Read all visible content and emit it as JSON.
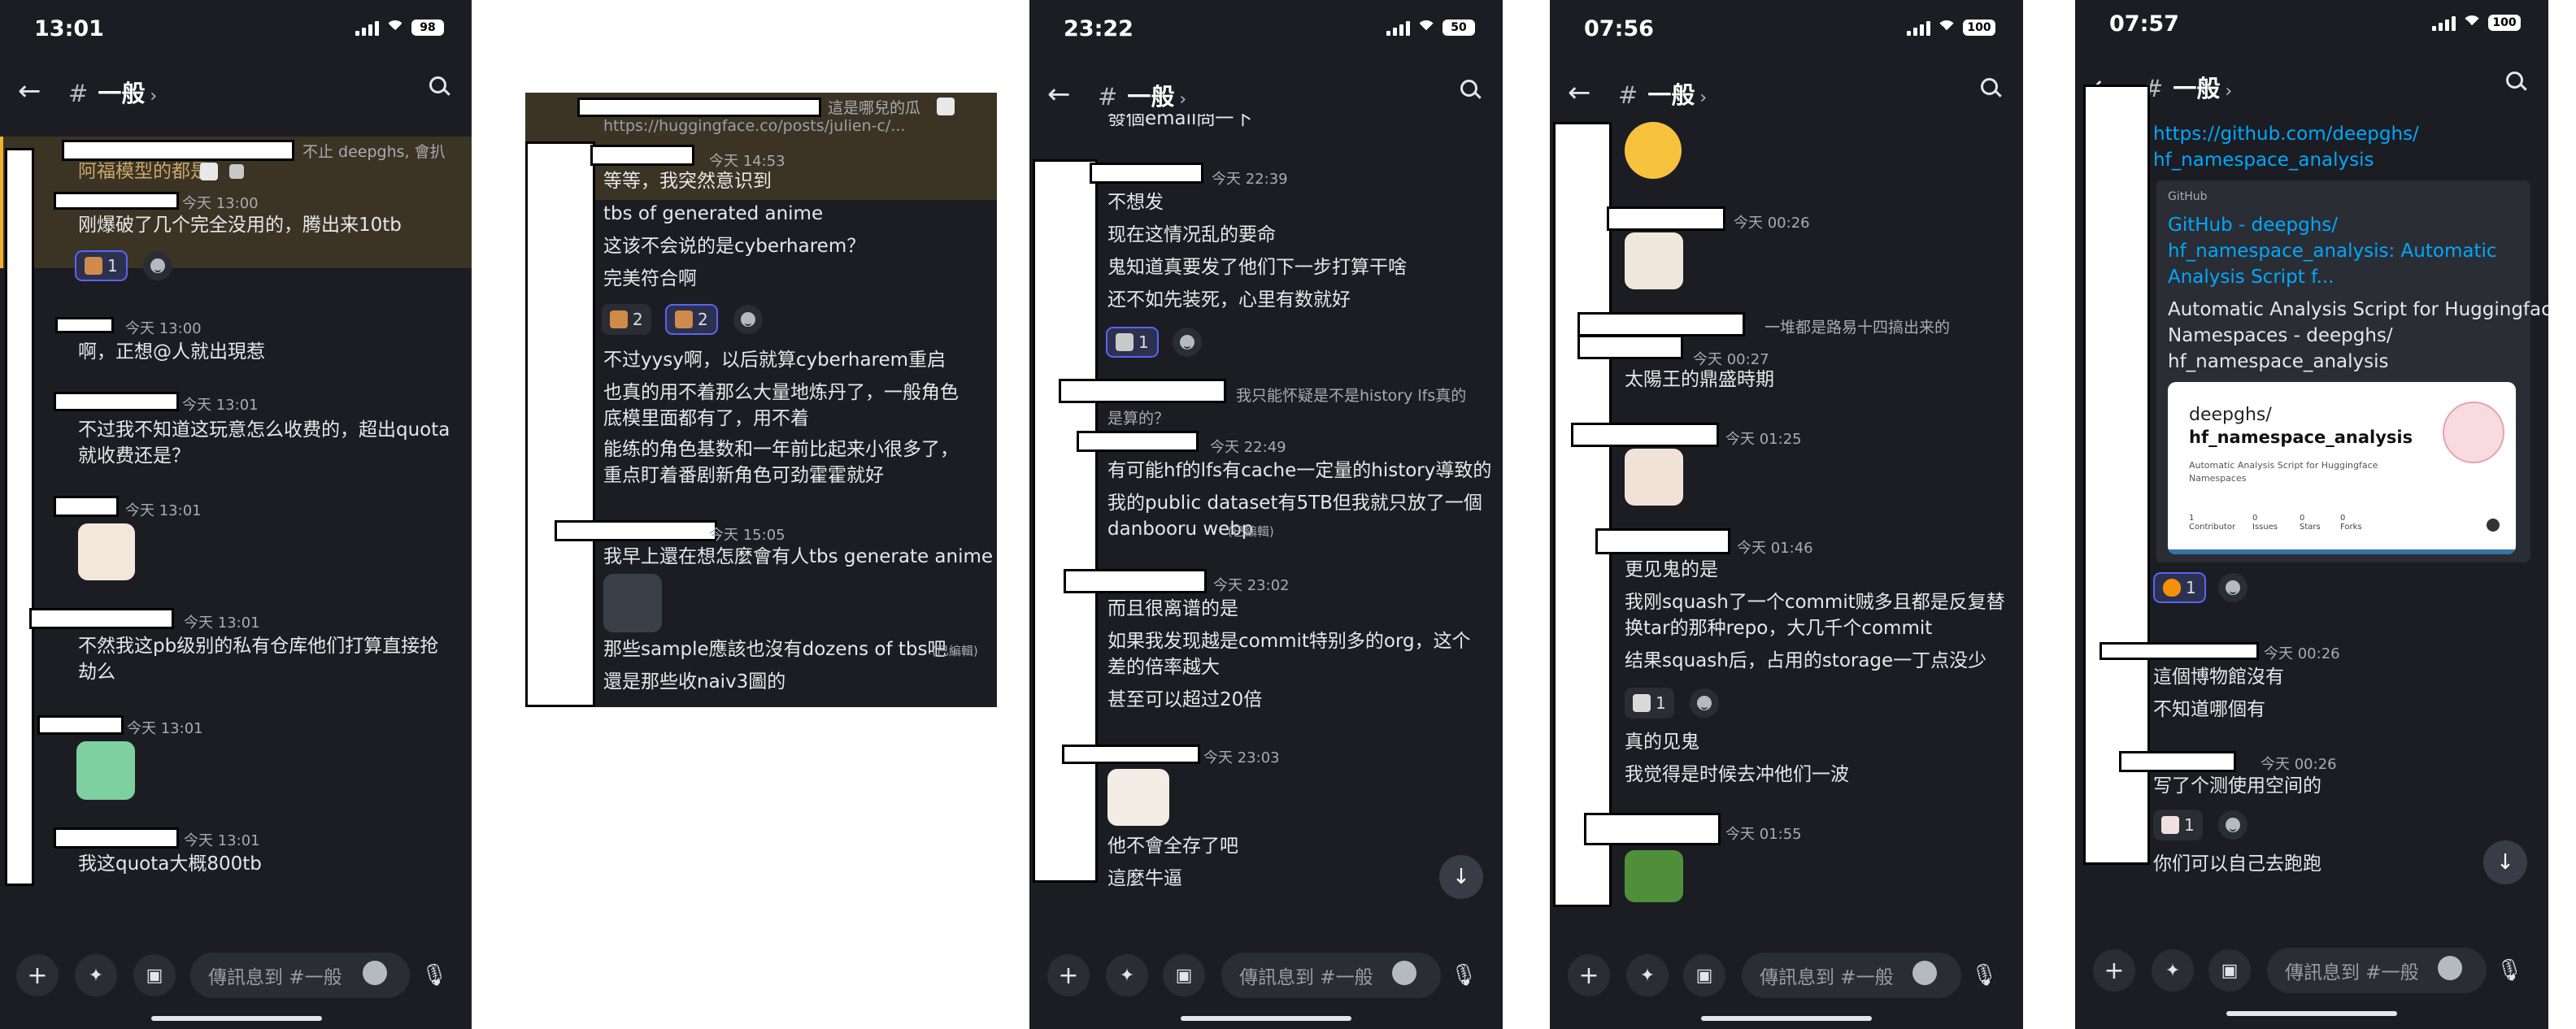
{
  "panels": [
    {
      "time": "13:01",
      "battery": "98",
      "channel": "一般",
      "placeholder": "傳訊息到 #一般",
      "messages": [
        {
          "reply": "不止 deepghs, 會扒"
        },
        {
          "text": "阿福模型的都是"
        },
        {
          "ts": "今天 13:00",
          "text": "刚爆破了几个完全没用的，腾出来10tb",
          "reaction_count": "1"
        },
        {
          "ts": "今天 13:00",
          "text": "啊，正想@人就出現惹"
        },
        {
          "ts": "今天 13:01",
          "lines": [
            "不过我不知道这玩意怎么收费的，超出quota",
            "就收费还是？"
          ]
        },
        {
          "ts": "今天 13:01"
        },
        {
          "ts": "今天 13:01",
          "lines": [
            "不然我这pb级别的私有仓库他们打算直接抢",
            "劫么"
          ]
        },
        {
          "ts": "今天 13:01"
        },
        {
          "ts": "今天 13:01",
          "text": "我这quota大概800tb"
        }
      ]
    },
    {
      "reply": "這是哪兒的瓜",
      "link": "https://huggingface.co/posts/julien-c/...",
      "messages": [
        {
          "ts": "今天 14:53",
          "lines": [
            "等等，我突然意识到",
            "tbs of generated anime",
            "这该不会说的是cyberharem？",
            "完美符合啊"
          ],
          "reactions": [
            "2",
            "2"
          ]
        },
        {
          "lines": [
            "不过yysy啊，以后就算cyberharem重启",
            "也真的用不着那么大量地炼丹了，一般角色",
            "底模里面都有了，用不着",
            "能练的角色基数和一年前比起来小很多了，",
            "重点盯着番剧新角色可劲霍霍就好"
          ]
        },
        {
          "ts": "今天 15:05",
          "lines": [
            "我早上還在想怎麼會有人tbs generate anime"
          ]
        },
        {
          "lines": [
            "那些sample應該也沒有dozens of tbs吧",
            "還是那些收naiv3圖的"
          ],
          "edited": "(已編輯)"
        }
      ]
    },
    {
      "time": "23:22",
      "battery": "50",
      "channel": "一般",
      "placeholder": "傳訊息到 #一般",
      "top_fragment": "發個email問一下",
      "messages": [
        {
          "ts": "今天 22:39",
          "lines": [
            "不想发",
            "现在这情况乱的要命",
            "鬼知道真要发了他们下一步打算干啥",
            "还不如先装死，心里有数就好"
          ],
          "reaction_count": "1"
        },
        {
          "reply": "我只能怀疑是不是history lfs真的",
          "reply2": "是算的？"
        },
        {
          "ts": "今天 22:49",
          "lines": [
            "有可能hf的lfs有cache一定量的history導致的",
            "我的public dataset有5TB但我就只放了一個",
            "danbooru webp"
          ],
          "edited": "(已編輯)"
        },
        {
          "ts": "今天 23:02",
          "lines": [
            "而且很离谱的是",
            "如果我发现越是commit特别多的org，这个",
            "差的倍率越大",
            "甚至可以超过20倍"
          ]
        },
        {
          "ts": "今天 23:03",
          "lines": [
            "他不會全存了吧",
            "這麼牛逼"
          ]
        }
      ]
    },
    {
      "time": "07:56",
      "battery": "100",
      "channel": "一般",
      "placeholder": "傳訊息到 #一般",
      "messages": [
        {
          "ts": "今天 00:26"
        },
        {
          "reply": "一堆都是路易十四搞出来的"
        },
        {
          "ts": "今天 00:27",
          "text": "太陽王的鼎盛時期"
        },
        {
          "ts": "今天 01:25"
        },
        {
          "ts": "今天 01:46",
          "lines": [
            "更见鬼的是",
            "我刚squash了一个commit贼多且都是反复替",
            "换tar的那种repo，大几千个commit",
            "结果squash后，占用的storage一丁点没少"
          ],
          "reaction_count": "1"
        },
        {
          "lines": [
            "真的见鬼",
            "我觉得是时候去冲他们一波"
          ]
        },
        {
          "ts": "今天 01:55"
        }
      ]
    },
    {
      "time": "07:57",
      "battery": "100",
      "channel": "一般",
      "placeholder": "傳訊息到 #一般",
      "link": [
        "https://github.com/deepghs/",
        "hf_namespace_analysis"
      ],
      "embed": {
        "site": "GitHub",
        "title": [
          "GitHub - deepghs/",
          "hf_namespace_analysis: Automatic",
          "Analysis Script f..."
        ],
        "desc": [
          "Automatic Analysis Script for Huggingface",
          "Namespaces - deepghs/",
          "hf_namespace_analysis"
        ],
        "card_owner": "deepghs/",
        "card_repo": "hf_namespace_analysis",
        "card_desc": [
          "Automatic Analysis Script for Huggingface",
          "Namespaces"
        ],
        "stats": [
          {
            "n": "1",
            "label": "Contributor"
          },
          {
            "n": "0",
            "label": "Issues"
          },
          {
            "n": "0",
            "label": "Stars"
          },
          {
            "n": "0",
            "label": "Forks"
          }
        ]
      },
      "reaction_count": "1",
      "messages": [
        {
          "ts": "今天 00:26",
          "lines": [
            "這個博物館沒有",
            "不知道哪個有"
          ]
        },
        {
          "ts": "今天 00:26",
          "lines": [
            "写了个测使用空间的"
          ],
          "reaction_count": "1"
        },
        {
          "lines": [
            "你们可以自己去跑跑"
          ]
        }
      ]
    }
  ]
}
